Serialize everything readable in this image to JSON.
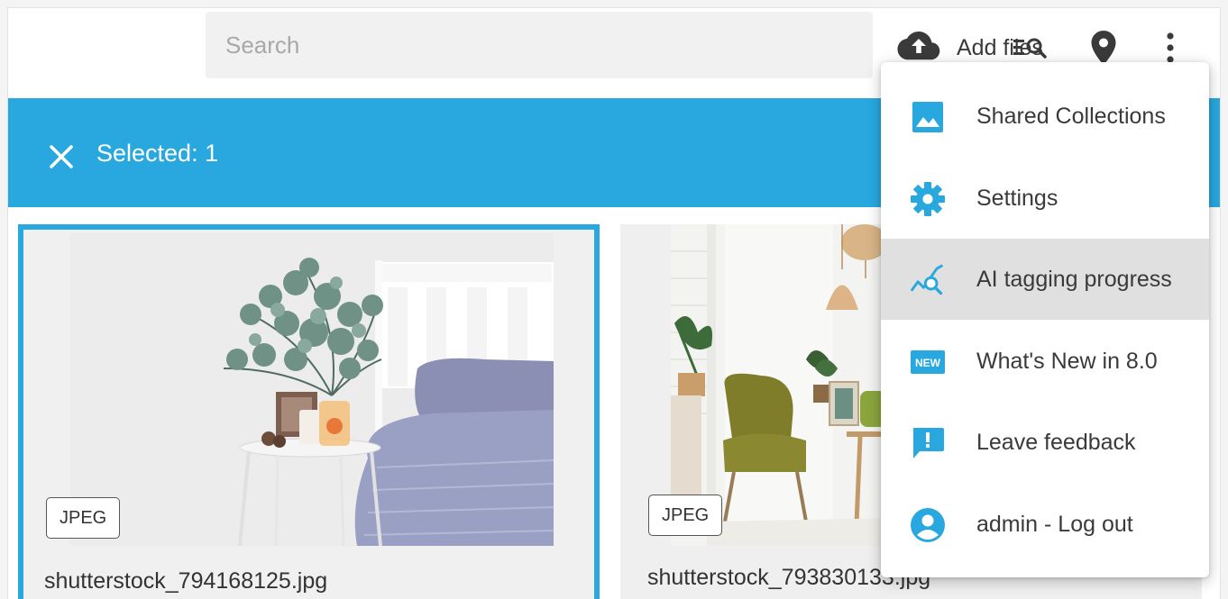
{
  "search": {
    "placeholder": "Search",
    "value": ""
  },
  "toolbar": {
    "add_files_label": "Add files"
  },
  "selection": {
    "label": "Selected: 1"
  },
  "cards": [
    {
      "format": "JPEG",
      "filename": "shutterstock_794168125.jpg",
      "selected": true
    },
    {
      "format": "JPEG",
      "filename": "shutterstock_793830133.jpg",
      "selected": false
    }
  ],
  "menu": {
    "items": [
      {
        "label": "Shared Collections",
        "icon": "image-icon"
      },
      {
        "label": "Settings",
        "icon": "gear-icon"
      },
      {
        "label": "AI tagging progress",
        "icon": "chart-search-icon",
        "highlighted": true
      },
      {
        "label": "What's New in 8.0",
        "icon": "new-badge-icon",
        "badge_text": "NEW"
      },
      {
        "label": "Leave feedback",
        "icon": "feedback-icon"
      },
      {
        "label": "admin - Log out",
        "icon": "account-circle-icon"
      }
    ]
  },
  "colors": {
    "accent": "#29a8e0",
    "menu_highlight": "#e0e0e0",
    "icon": "#3a3a3a"
  }
}
